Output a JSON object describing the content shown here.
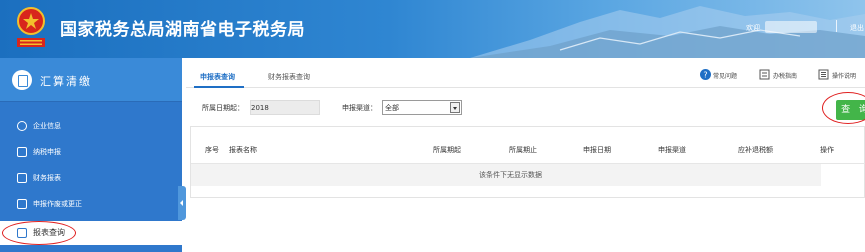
{
  "header": {
    "site_title": "国家税务总局湖南省电子税务局",
    "welcome": "欢迎",
    "logout": "退出"
  },
  "sidebar": {
    "title": "汇算清缴",
    "items": [
      {
        "label": "企业信息",
        "icon": "info-icon"
      },
      {
        "label": "纳税申报",
        "icon": "declare-icon"
      },
      {
        "label": "财务报表",
        "icon": "report-icon"
      },
      {
        "label": "申报作废或更正",
        "icon": "correction-icon"
      },
      {
        "label": "报表查询",
        "icon": "query-icon",
        "active": true
      }
    ]
  },
  "tabs": [
    {
      "label": "申报表查询",
      "active": true
    },
    {
      "label": "财务报表查询",
      "active": false
    }
  ],
  "toolbar": {
    "faq": "常见问题",
    "guide": "办税指南",
    "manual": "操作说明"
  },
  "filters": {
    "period_label": "所属日期起：",
    "period_value": "2018",
    "channel_label": "申报渠道：",
    "channel_value": "全部"
  },
  "query_button": "查 询",
  "table": {
    "headers": [
      "序号",
      "报表名称",
      "所属期起",
      "所属期止",
      "申报日期",
      "申报渠道",
      "应补退税额",
      "操作"
    ],
    "empty_message": "该条件下无显示数据"
  },
  "colors": {
    "header_blue": "#1b6fbf",
    "sidebar_blue": "#2f78cc",
    "query_green": "#43b549",
    "annotation_red": "#e02020"
  }
}
